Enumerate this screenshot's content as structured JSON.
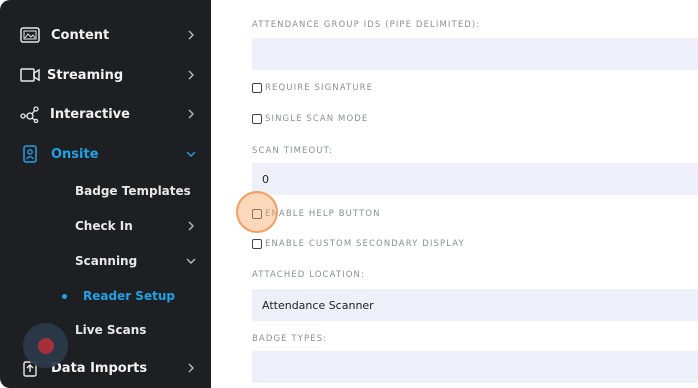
{
  "sidebar": {
    "nav": [
      {
        "label": "Content",
        "icon": "image-icon"
      },
      {
        "label": "Streaming",
        "icon": "video-icon"
      },
      {
        "label": "Interactive",
        "icon": "network-icon"
      },
      {
        "label": "Onsite",
        "icon": "badge-icon"
      }
    ],
    "onsite_sub": [
      {
        "label": "Badge Templates"
      },
      {
        "label": "Check In"
      },
      {
        "label": "Scanning"
      },
      {
        "label": "Reader Setup"
      },
      {
        "label": "Live Scans"
      }
    ],
    "data_imports": {
      "label": "Data Imports",
      "icon": "import-icon"
    }
  },
  "form": {
    "attendance_group_label": "ATTENDANCE GROUP IDS (PIPE DELIMITED):",
    "attendance_group_value": "",
    "require_signature": "REQUIRE SIGNATURE",
    "single_scan_mode": "SINGLE SCAN MODE",
    "scan_timeout_label": "SCAN TIMEOUT:",
    "scan_timeout_value": "0",
    "enable_help_button": "ENABLE HELP BUTTON",
    "enable_custom_secondary_display": "ENABLE CUSTOM SECONDARY DISPLAY",
    "attached_location_label": "ATTACHED LOCATION:",
    "attached_location_value": "Attendance Scanner",
    "badge_types_label": "BADGE TYPES:",
    "badge_types_value": ""
  },
  "colors": {
    "sidebar_bg": "#1e1f22",
    "accent": "#1fa3e6",
    "input_bg": "#eef0f9",
    "highlight": "#f0a060"
  }
}
